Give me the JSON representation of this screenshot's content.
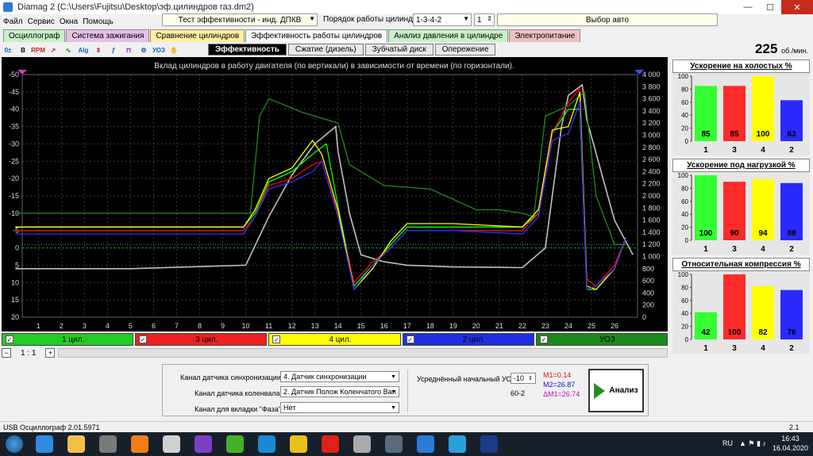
{
  "window": {
    "title": "Diamag 2 (C:\\Users\\Fujitsu\\Desktop\\эф.цилиндров газ.dm2)"
  },
  "menu": [
    "Файл",
    "Сервис",
    "Окна",
    "Помощь"
  ],
  "top": {
    "test": "Тест эффективности - инд. ДПКВ",
    "order_label": "Порядок работы цилиндров",
    "order_value": "1-3-4-2",
    "spin_value": "1",
    "auto_select": "Выбор авто"
  },
  "tabs": [
    {
      "label": "Осциллограф",
      "color": "#c8f0c8"
    },
    {
      "label": "Система зажигания",
      "color": "#e6c0e6"
    },
    {
      "label": "Сравнение цилиндров",
      "color": "#fff0a0"
    },
    {
      "label": "Эффективность работы цилиндров",
      "color": "#f8f8f8"
    },
    {
      "label": "Анализ давления в цилиндре",
      "color": "#c8f0c8"
    },
    {
      "label": "Электропитание",
      "color": "#f0c0c0"
    }
  ],
  "toolbar_icons": [
    "0-icon",
    "bold-b-icon",
    "rpm-icon",
    "cursor-icon",
    "wave-icon",
    "alg-icon",
    "scale-icon",
    "freq-icon",
    "filter-icon",
    "engine-icon",
    "uoz-icon",
    "hand-icon"
  ],
  "subtabs": [
    "Эффективность",
    "Сжатие (дизель)",
    "Зубчатый диск",
    "Опережение"
  ],
  "rpm": {
    "value": "225",
    "unit": "об./мин."
  },
  "chart_data": {
    "type": "line",
    "title": "Вклад цилиндров в работу двигателя (по вертикали) в зависимости от времени (по горизонтали).",
    "x_ticks": [
      "1",
      "2",
      "3",
      "4",
      "5",
      "6",
      "7",
      "8",
      "9",
      "10",
      "11",
      "12",
      "13",
      "14",
      "15",
      "16",
      "17",
      "18",
      "19",
      "20",
      "21",
      "22",
      "23",
      "24",
      "25",
      "26"
    ],
    "y_left_ticks": [
      "-50",
      "-45",
      "-40",
      "-35",
      "-30",
      "-25",
      "-20",
      "-15",
      "-10",
      "-5",
      "0",
      "5",
      "10",
      "15",
      "20"
    ],
    "y_right_ticks": [
      "4 000",
      "3 800",
      "3 600",
      "3 400",
      "3 200",
      "3 000",
      "2 800",
      "2 600",
      "2 400",
      "2 200",
      "2 000",
      "1 800",
      "1 600",
      "1 400",
      "1 200",
      "1 000",
      "800",
      "600",
      "400",
      "200",
      "0"
    ],
    "ylim_left": [
      -50,
      20
    ],
    "ylim_right": [
      0,
      4000
    ],
    "series": [
      {
        "name": "1 цил.",
        "color": "#00ff00",
        "x": [
          0,
          9.9,
          10.4,
          11,
          12,
          12.9,
          13.5,
          14,
          14.7,
          15.5,
          16.3,
          17,
          19,
          22,
          22.7,
          23.3,
          24,
          24.5,
          24.8,
          25.2,
          26,
          26.5
        ],
        "y": [
          -6,
          -6,
          -10,
          -19,
          -22,
          -27,
          -30,
          -12,
          11,
          5,
          -1,
          -6,
          -6,
          -6,
          -10,
          -33,
          -40,
          -40,
          12,
          12,
          6,
          -3
        ]
      },
      {
        "name": "3 цил.",
        "color": "#ff0000",
        "x": [
          0,
          9.9,
          10.4,
          11,
          12,
          12.9,
          13.3,
          14,
          14.7,
          15.5,
          16.3,
          17,
          19,
          22,
          22.7,
          23.3,
          24,
          24.5,
          24.8,
          25.2,
          26,
          26.5
        ],
        "y": [
          -5,
          -5,
          -9,
          -18,
          -20,
          -24,
          -25,
          -10,
          10,
          4,
          0,
          -5,
          -5,
          -5,
          -10,
          -33,
          -42,
          -46,
          9,
          11,
          5,
          -3
        ]
      },
      {
        "name": "4 цил.",
        "color": "#ffff00",
        "x": [
          0,
          9.9,
          10.4,
          11,
          12,
          12.9,
          13.3,
          14,
          14.7,
          15.5,
          16.3,
          17,
          19,
          22,
          22.7,
          23.3,
          24,
          24.5,
          24.8,
          25.2,
          26,
          26.5
        ],
        "y": [
          -6,
          -6,
          -11,
          -20,
          -23,
          -31,
          -27,
          -11,
          12,
          6,
          -2,
          -7,
          -7,
          -6,
          -11,
          -34,
          -35,
          -45,
          11,
          12,
          6,
          -3
        ]
      },
      {
        "name": "2 цил.",
        "color": "#3030ff",
        "x": [
          0,
          9.9,
          10.4,
          11,
          12,
          12.9,
          13.3,
          14,
          14.7,
          15.5,
          16.3,
          17,
          19,
          22,
          22.7,
          23.3,
          24,
          24.5,
          24.8,
          25.2,
          26,
          26.5
        ],
        "y": [
          -4,
          -4,
          -9,
          -17,
          -19,
          -22,
          -25,
          -9,
          12,
          5,
          0,
          -5,
          -5,
          -4,
          -9,
          -31,
          -33,
          -42,
          12,
          11,
          6,
          -3
        ]
      },
      {
        "name": "УОЗ",
        "color": "#1f8a1f",
        "x": [
          0,
          10.2,
          10.6,
          11,
          12.5,
          13.5,
          14,
          14.5,
          16,
          18,
          19,
          20,
          21,
          22,
          22.5,
          23,
          24,
          24.7,
          25.2,
          26,
          26.5
        ],
        "y": [
          -10,
          -10,
          -38,
          -43,
          -39,
          -37,
          -36,
          -24,
          -18,
          -17,
          -14,
          -11,
          -11,
          -10,
          -9,
          -38,
          -41,
          -45,
          -15,
          -1,
          -1
        ]
      },
      {
        "name": "обороты",
        "color": "#c0c0c0",
        "x": [
          0,
          2,
          5,
          10,
          11,
          12,
          13,
          13.9,
          14,
          14.5,
          15,
          16,
          17,
          19,
          21,
          22,
          23,
          23.7,
          24,
          24.6,
          24.8,
          25.5,
          26,
          26.8
        ],
        "y": [
          6,
          6,
          6,
          5,
          -9,
          -21,
          -30,
          -35,
          -28,
          -10,
          2,
          4,
          5,
          5.5,
          5.6,
          5.7,
          0,
          -35,
          -44,
          -47,
          -37,
          -20,
          -8,
          2
        ]
      }
    ]
  },
  "legend": [
    {
      "name": "1 цил.",
      "color": "#22cc22"
    },
    {
      "name": "3 цил.",
      "color": "#ee2020"
    },
    {
      "name": "4 цил.",
      "color": "#ffff00"
    },
    {
      "name": "2 цил.",
      "color": "#2030e0"
    },
    {
      "name": "УОЗ",
      "color": "#1a8a1a"
    }
  ],
  "zoom": {
    "value": "1 : 1"
  },
  "panels": [
    {
      "title": "Ускорение на холостых %",
      "ticks": [
        "100",
        "80",
        "60",
        "40",
        "20",
        "0"
      ],
      "bars": [
        {
          "label": "1",
          "value": 85,
          "color": "#33ff33"
        },
        {
          "label": "3",
          "value": 85,
          "color": "#ff2a2a"
        },
        {
          "label": "4",
          "value": 100,
          "color": "#ffff00"
        },
        {
          "label": "2",
          "value": 63,
          "color": "#2a2aff"
        }
      ]
    },
    {
      "title": "Ускорение под нагрузкой %",
      "ticks": [
        "100",
        "80",
        "60",
        "40",
        "20",
        "0"
      ],
      "bars": [
        {
          "label": "1",
          "value": 100,
          "color": "#33ff33"
        },
        {
          "label": "3",
          "value": 90,
          "color": "#ff2a2a"
        },
        {
          "label": "4",
          "value": 94,
          "color": "#ffff00"
        },
        {
          "label": "2",
          "value": 88,
          "color": "#2a2aff"
        }
      ]
    },
    {
      "title": "Относительная компрессия %",
      "ticks": [
        "100",
        "80",
        "60",
        "40",
        "20",
        "0"
      ],
      "bars": [
        {
          "label": "1",
          "value": 42,
          "color": "#33ff33"
        },
        {
          "label": "3",
          "value": 100,
          "color": "#ff2a2a"
        },
        {
          "label": "4",
          "value": 82,
          "color": "#ffff00"
        },
        {
          "label": "2",
          "value": 76,
          "color": "#2a2aff"
        }
      ]
    }
  ],
  "bottom": {
    "sync_label": "Канал датчика синхронизации",
    "sync_value": "4.  Датчик синхронизации",
    "crank_label": "Канал датчика коленвала",
    "crank_value": "2.  Датчик Полож Коленчатого Вал",
    "phase_label": "Канал для вкладки \"Фаза\"",
    "phase_value": "Нет",
    "avg_label": "Усреднённый начальный УОЗ",
    "avg_value": "-10",
    "wheel": "60-2",
    "m1": "M1=0.14",
    "m2": "M2=26.87",
    "dm": "ΔM1=26.74",
    "analyze": "Анализ"
  },
  "status": {
    "left": "USB Осциллограф  2.01.5971",
    "right": "2.1"
  },
  "taskbar": {
    "lang": "RU",
    "time": "16:43",
    "date": "16.04.2020",
    "apps": [
      {
        "name": "ie-icon",
        "color": "#2f8be0"
      },
      {
        "name": "folder-icon",
        "color": "#f3c14a"
      },
      {
        "name": "media-icon",
        "color": "#7a7a7a"
      },
      {
        "name": "avast-icon",
        "color": "#f27d1a"
      },
      {
        "name": "app-icon",
        "color": "#d0d0d0"
      },
      {
        "name": "vs-icon",
        "color": "#7b3fc4"
      },
      {
        "name": "utorrent-icon",
        "color": "#45b02a"
      },
      {
        "name": "ccleaner-icon",
        "color": "#1a8ad4"
      },
      {
        "name": "chrome-icon",
        "color": "#e8c11a"
      },
      {
        "name": "opera-icon",
        "color": "#e0201a"
      },
      {
        "name": "pen-icon",
        "color": "#aaaaaa"
      },
      {
        "name": "steam-icon",
        "color": "#5a6a7a"
      },
      {
        "name": "moon-icon",
        "color": "#2a7bd4"
      },
      {
        "name": "telegram-icon",
        "color": "#2aa0da"
      },
      {
        "name": "diamag-icon",
        "color": "#1a3a8a"
      }
    ]
  }
}
